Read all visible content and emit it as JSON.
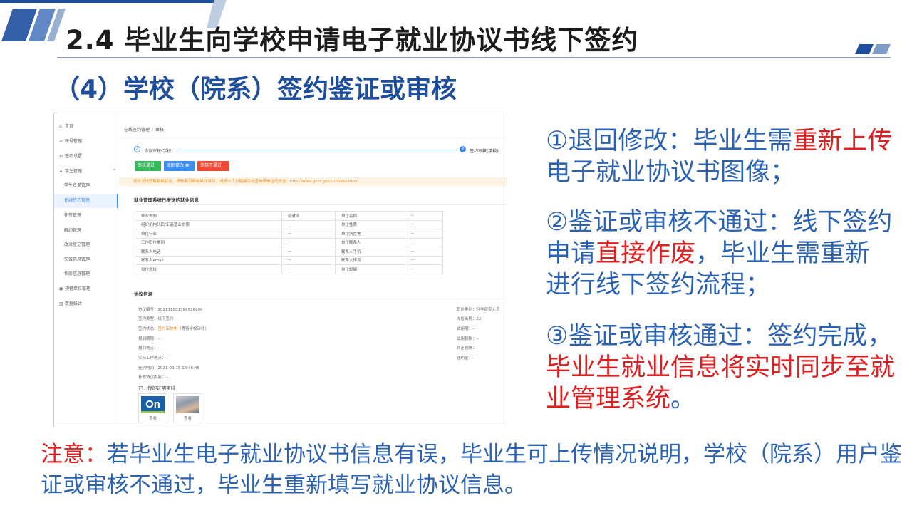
{
  "slide": {
    "title": "2.4 毕业生向学校申请电子就业协议书线下签约",
    "subtitle": "（4）学校（院系）签约鉴证或审核"
  },
  "colors": {
    "accent_blue": "#2b62b1",
    "highlight_red": "#e02020",
    "ui_primary": "#3d8df2",
    "ui_success": "#35b85b",
    "ui_danger": "#ef4a35",
    "ui_warning": "#e68a1f"
  },
  "sidebar": {
    "items": [
      {
        "icon": "home-icon",
        "glyph": "⌂",
        "label": "首页"
      },
      {
        "icon": "account-icon",
        "glyph": "≡",
        "label": "账号管理"
      },
      {
        "icon": "settings-icon",
        "glyph": "⚙",
        "label": "签约设置"
      },
      {
        "icon": "student-icon",
        "glyph": "♟",
        "label": "学生管理",
        "expand": "^"
      },
      {
        "icon": "alert-icon",
        "glyph": "●",
        "label": "预警单位管理"
      },
      {
        "icon": "chart-icon",
        "glyph": "▥",
        "label": "数据统计"
      }
    ],
    "sub_items": [
      "学生名单管理",
      "在线签约管理",
      "补签管理",
      "解约管理",
      "改派登记管理",
      "失效信息管理",
      "作废信息管理"
    ]
  },
  "breadcrumb": {
    "parent": "在线签约管理",
    "separator": "/",
    "current": "审核"
  },
  "steps": {
    "step1": {
      "mark": "✓",
      "label": "协议审核(学校)"
    },
    "step2": {
      "mark": "2",
      "label": "签约审核(学校)"
    }
  },
  "buttons": {
    "pass": "审核通过",
    "back": "退回修改 ❷",
    "fail": "审核不通过"
  },
  "warning": "按时无法获取最新状态，请刷新页面或再次尝试，或点击下方链接手动查询该单位的状态。http://www.gxxt.gov.cn/index.html",
  "employment": {
    "section_title": "就业管理系统已报送的就业信息",
    "rows": [
      [
        "毕业去向",
        "待就业",
        "单位名称",
        "--"
      ],
      [
        "组织机构代码/工商营业执照",
        "--",
        "单位性质",
        "--"
      ],
      [
        "单位行业",
        "--",
        "单位所在地",
        "--"
      ],
      [
        "工作职位类别",
        "--",
        "单位联系人",
        "--"
      ],
      [
        "联系人电话",
        "--",
        "联系人手机",
        "--"
      ],
      [
        "联系人email",
        "--",
        "联系人传真",
        "--"
      ],
      [
        "单位地址",
        "--",
        "单位邮编",
        "--"
      ]
    ]
  },
  "agreement": {
    "section_title": "协议信息",
    "left": [
      {
        "label": "协议编号：",
        "value": "202111001399526998"
      },
      {
        "label": "签约类型：",
        "value": "线下签约"
      },
      {
        "label": "签约状态：",
        "value": "签约审核中",
        "note": "（等待学校审核）"
      },
      {
        "label": "报到期限：",
        "value": "--"
      },
      {
        "label": "报到地点：",
        "value": "--"
      },
      {
        "label": "实际工作地点：",
        "value": "--"
      },
      {
        "label": "签约时间：",
        "value": "2021-09-15 15:46:45"
      },
      {
        "label": "补充协议内容：",
        "value": "--"
      }
    ],
    "right": [
      {
        "label": "职位类别：",
        "value": "科学研究人员"
      },
      {
        "label": "岗位名称：",
        "value": "22"
      },
      {
        "label": "试用期：",
        "value": "--"
      },
      {
        "label": "试用薪酬：",
        "value": "--"
      },
      {
        "label": "转正薪酬：",
        "value": "--"
      },
      {
        "label": "违约金：",
        "value": "--"
      }
    ]
  },
  "uploads": {
    "title": "已上传的证明资料",
    "files": [
      {
        "thumb_text": "On",
        "action": "查看"
      },
      {
        "thumb_text": "",
        "action": "查看"
      }
    ]
  },
  "points": [
    {
      "prefix": "①退回修改：毕业生需",
      "highlight": "重新上传",
      "suffix": "电子就业协议书图像；"
    },
    {
      "prefix": "②鉴证或审核不通过：线下签约申请",
      "highlight": "直接作废",
      "suffix": "，毕业生需重新进行线下签约流程；"
    },
    {
      "prefix": "③鉴证或审核通过：签约完成，",
      "highlight": "毕业生就业信息将实时同步至就业管理系统",
      "suffix": "。"
    }
  ],
  "note": {
    "label": "注意：",
    "text": "若毕业生电子就业协议书信息有误，毕业生可上传情况说明，学校（院系）用户鉴证或审核不通过，毕业生重新填写就业协议信息。"
  }
}
